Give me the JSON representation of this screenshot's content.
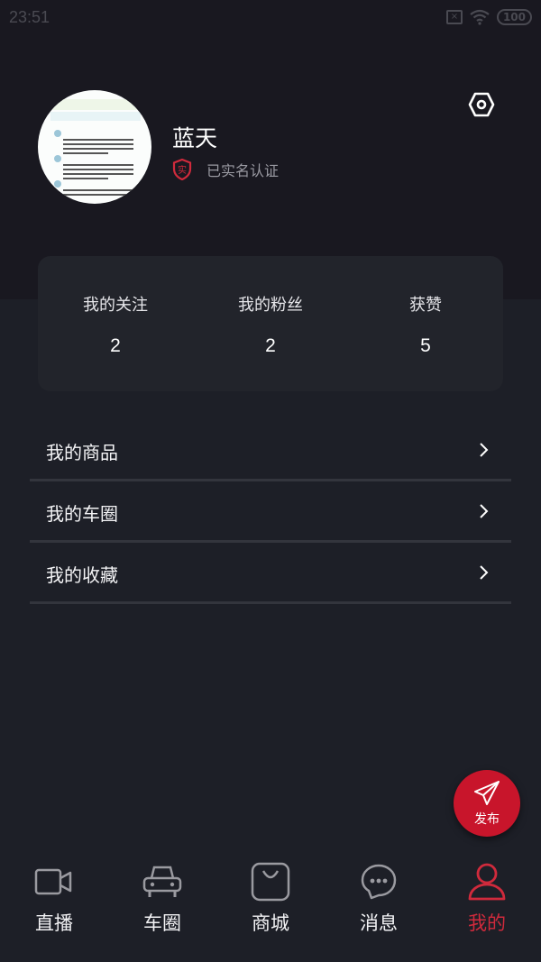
{
  "status_bar": {
    "time": "23:51",
    "battery": "100",
    "icons": [
      "sim-off-icon",
      "wifi-icon",
      "battery-icon"
    ]
  },
  "profile": {
    "name": "蓝天",
    "verification": "已实名认证",
    "verify_badge": "实",
    "settings_icon": "settings-icon"
  },
  "stats": [
    {
      "label": "我的关注",
      "value": "2"
    },
    {
      "label": "我的粉丝",
      "value": "2"
    },
    {
      "label": "获赞",
      "value": "5"
    }
  ],
  "menu": [
    {
      "label": "我的商品"
    },
    {
      "label": "我的车圈"
    },
    {
      "label": "我的收藏"
    }
  ],
  "fab": {
    "label": "发布",
    "icon": "paper-plane-icon"
  },
  "tabs": [
    {
      "label": "直播",
      "icon": "video-camera-icon",
      "active": false
    },
    {
      "label": "车圈",
      "icon": "car-icon",
      "active": false
    },
    {
      "label": "商城",
      "icon": "shopping-bag-icon",
      "active": false
    },
    {
      "label": "消息",
      "icon": "chat-bubble-icon",
      "active": false
    },
    {
      "label": "我的",
      "icon": "person-icon",
      "active": true
    }
  ],
  "colors": {
    "accent": "#c8152b",
    "active_tab": "#d02a3c",
    "background": "#1d1f27",
    "header_background": "#191820",
    "card": "#22242b"
  }
}
